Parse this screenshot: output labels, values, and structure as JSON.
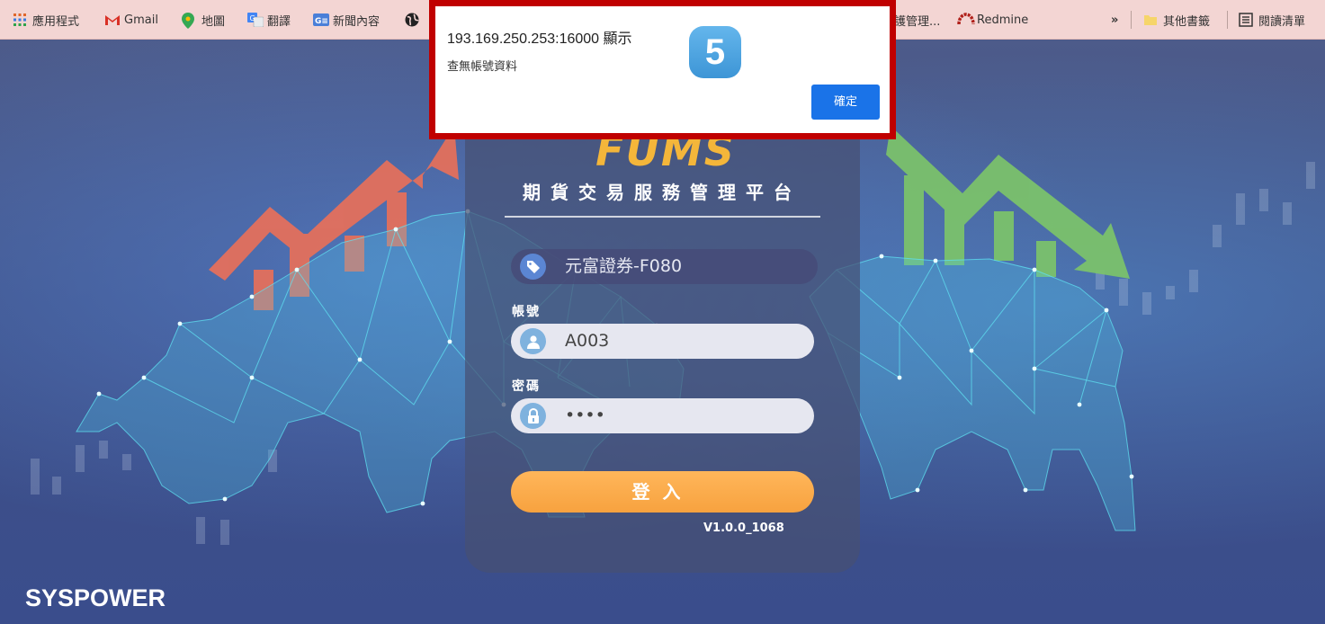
{
  "bookmarks": {
    "items": [
      {
        "label": "應用程式",
        "icon": "apps-grid-icon"
      },
      {
        "label": "Gmail",
        "icon": "gmail-icon"
      },
      {
        "label": "地圖",
        "icon": "maps-pin-icon"
      },
      {
        "label": "翻譯",
        "icon": "translate-icon"
      },
      {
        "label": "新聞內容",
        "icon": "news-icon"
      },
      {
        "label": "",
        "icon": "globe-icon"
      },
      {
        "label": "護管理...",
        "icon": ""
      },
      {
        "label": "Redmine",
        "icon": "redmine-icon"
      }
    ],
    "overflow": "»",
    "other_bookmarks": "其他書籤",
    "reading_list": "閱讀清單"
  },
  "alert": {
    "title": "193.169.250.253:16000 顯示",
    "message": "查無帳號資料",
    "ok_label": "確定",
    "step_badge": "5"
  },
  "login": {
    "logo_text": "FUMS",
    "subtitle": "期貨交易服務管理平台",
    "company": "元富證券-F080",
    "account_label": "帳號",
    "account_value": "A003",
    "password_label": "密碼",
    "password_value": "••••",
    "login_button": "登入",
    "version": "V1.0.0_1068"
  },
  "footer": {
    "brand": "SYSPOWER"
  },
  "colors": {
    "alert_border": "#c00000",
    "ok_button": "#1a73e8",
    "login_button": "#f7a23f",
    "bull_arrow": "#e8705a",
    "bear_arrow": "#7cc46a",
    "mesh": "#5fe0f0"
  }
}
